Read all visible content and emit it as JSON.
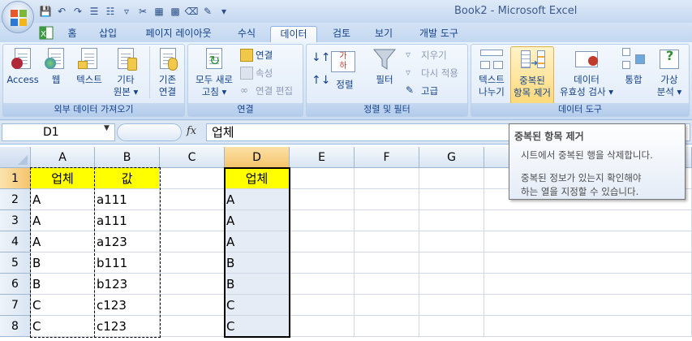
{
  "window": {
    "title": "Book2 - Microsoft Excel"
  },
  "tabs": [
    "홈",
    "삽입",
    "페이지 레이아웃",
    "수식",
    "데이터",
    "검토",
    "보기",
    "개발 도구"
  ],
  "active_tab": "데이터",
  "ribbon": {
    "external": {
      "label": "외부 데이터 가져오기",
      "access": "Access",
      "web": "웹",
      "text": "텍스트",
      "other1": "기타",
      "other2": "원본 ▾",
      "existing1": "기존",
      "existing2": "연결"
    },
    "connections": {
      "label": "연결",
      "refresh1": "모두 새로",
      "refresh2": "고침 ▾",
      "connections": "연결",
      "properties": "속성",
      "edit_links": "연결 편집"
    },
    "sort_filter": {
      "label": "정렬 및 필터",
      "sort_az": "가",
      "sort_az2": "하",
      "sort": "정렬",
      "filter": "필터",
      "clear": "지우기",
      "reapply": "다시 적용",
      "advanced": "고급"
    },
    "data_tools": {
      "label": "데이터 도구",
      "text_to_columns1": "텍스트",
      "text_to_columns2": "나누기",
      "remove_dup1": "중복된",
      "remove_dup2": "항목 제거",
      "validation1": "데이터",
      "validation2": "유효성 검사 ▾",
      "consolidate": "통합",
      "whatif1": "가상",
      "whatif2": "분석 ▾"
    }
  },
  "formula_bar": {
    "name_box": "D1",
    "fx": "fx",
    "formula": "업체"
  },
  "columns": [
    "A",
    "B",
    "C",
    "D",
    "E",
    "F",
    "G"
  ],
  "rows": [
    "1",
    "2",
    "3",
    "4",
    "5",
    "6",
    "7",
    "8"
  ],
  "cells": {
    "A": [
      "업체",
      "A",
      "A",
      "A",
      "B",
      "B",
      "C",
      "C"
    ],
    "B": [
      "값",
      "a111",
      "a111",
      "a123",
      "b111",
      "b123",
      "c123",
      "c123"
    ],
    "D": [
      "업체",
      "A",
      "A",
      "A",
      "B",
      "B",
      "C",
      "C"
    ]
  },
  "tooltip": {
    "title": "중복된 항목 제거",
    "line1": "시트에서 중복된 행을 삭제합니다.",
    "line2": "중복된 정보가 있는지 확인해야",
    "line3": "하는 열을 지정할 수 있습니다."
  },
  "colors": {
    "header_yellow": "#ffff00",
    "selection": "#f6c46b",
    "ribbon_text": "#15428b"
  }
}
